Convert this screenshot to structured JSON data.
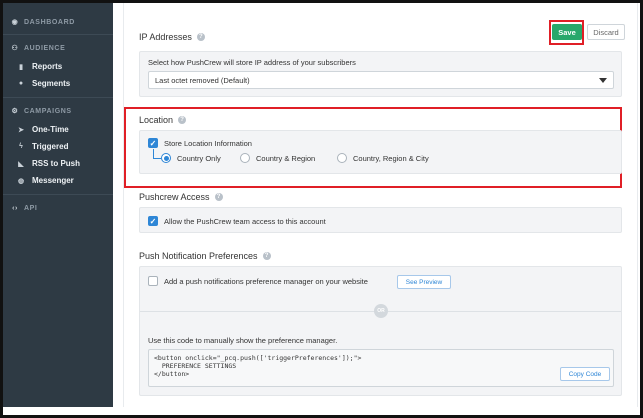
{
  "sidebar": {
    "sections": [
      {
        "icon": "eye-icon",
        "label": "DASHBOARD"
      },
      {
        "icon": "users-icon",
        "label": "AUDIENCE"
      },
      {
        "icon": "campaigns-icon",
        "label": "CAMPAIGNS"
      },
      {
        "icon": "code-icon",
        "label": "API"
      }
    ],
    "audience_items": [
      {
        "icon": "bar-chart-icon",
        "label": "Reports"
      },
      {
        "icon": "pie-chart-icon",
        "label": "Segments"
      }
    ],
    "campaign_items": [
      {
        "icon": "send-icon",
        "label": "One-Time"
      },
      {
        "icon": "bolt-icon",
        "label": "Triggered"
      },
      {
        "icon": "rss-icon",
        "label": "RSS to Push"
      },
      {
        "icon": "messenger-icon",
        "label": "Messenger"
      }
    ]
  },
  "toolbar": {
    "save_label": "Save",
    "discard_label": "Discard"
  },
  "ip": {
    "title": "IP Addresses",
    "description": "Select how PushCrew will store IP address of your subscribers",
    "selected": "Last octet removed (Default)"
  },
  "location": {
    "title": "Location",
    "store_label": "Store Location Information",
    "store_checked": true,
    "options": [
      "Country Only",
      "Country & Region",
      "Country, Region & City"
    ],
    "selected_index": 0
  },
  "access": {
    "title": "Pushcrew Access",
    "label": "Allow the PushCrew team access to this account",
    "checked": true
  },
  "prefs": {
    "title": "Push Notification Preferences",
    "label": "Add a push notifications preference manager on your website",
    "checked": false,
    "preview_label": "See Preview",
    "or_label": "OR",
    "manual_label": "Use this code to manually show the preference manager.",
    "code": "<button onclick=\"_pcq.push(['triggerPreferences']);\">\n  PREFERENCE SETTINGS\n</button>",
    "copy_label": "Copy Code"
  },
  "colors": {
    "accent": "#2e86d6",
    "save": "#28a86b",
    "highlight": "#e01f26",
    "sidebar": "#2e3a44"
  }
}
